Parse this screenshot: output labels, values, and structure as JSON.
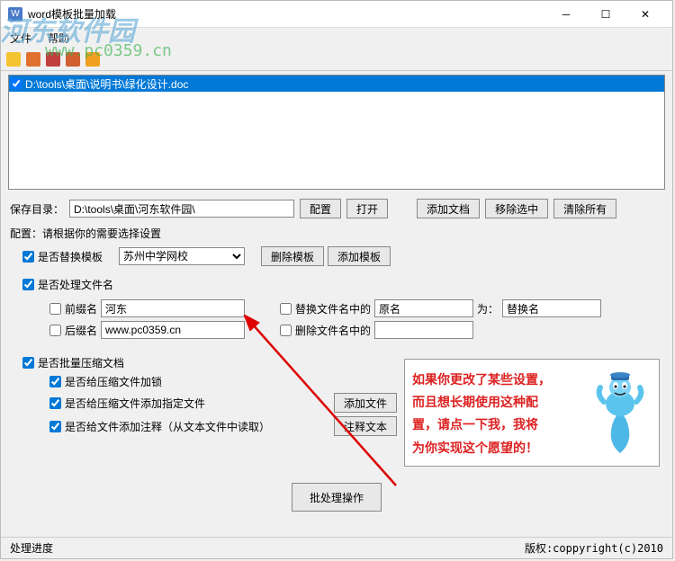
{
  "titlebar": {
    "text": "word模板批量加载"
  },
  "menubar": {
    "file": "文件",
    "help": "帮助"
  },
  "toolbar_icons": [
    "new",
    "open",
    "home",
    "exit",
    "star"
  ],
  "listbox": {
    "item": "D:\\tools\\桌面\\说明书\\绿化设计.doc"
  },
  "save": {
    "label": "保存目录：",
    "path": "D:\\tools\\桌面\\河东软件园\\",
    "btn_config": "配置",
    "btn_open": "打开",
    "btn_add_doc": "添加文档",
    "btn_remove_sel": "移除选中",
    "btn_clear_all": "清除所有"
  },
  "config_label": "配置：请根据你的需要选择设置",
  "template": {
    "cb_label": "是否替换模板",
    "selected": "苏州中学网校",
    "btn_delete": "删除模板",
    "btn_add": "添加模板"
  },
  "filename": {
    "cb_label": "是否处理文件名",
    "prefix_label": "前缀名",
    "prefix_value": "河东",
    "suffix_label": "后缀名",
    "suffix_value": "www.pc0359.cn",
    "replace_label": "替换文件名中的",
    "replace_from": "原名",
    "replace_to_label": "为：",
    "replace_to": "替换名",
    "delete_label": "删除文件名中的"
  },
  "compress": {
    "cb_label": "是否批量压缩文档",
    "lock": "是否给压缩文件加锁",
    "addfile": "是否给压缩文件添加指定文件",
    "comment": "是否给文件添加注释（从文本文件中读取）",
    "btn_add_file": "添加文件",
    "btn_comment_text": "注释文本"
  },
  "tip": {
    "line1": "如果你更改了某些设置，",
    "line2": "而且想长期使用这种配",
    "line3": "置，请点一下我，我将",
    "line4": "为你实现这个愿望的！"
  },
  "main_action": "批处理操作",
  "footer": {
    "left": "处理进度",
    "right": "版权:coppyright(c)2010"
  },
  "watermark": {
    "text": "河东软件园",
    "url": "www.pc0359.cn"
  }
}
